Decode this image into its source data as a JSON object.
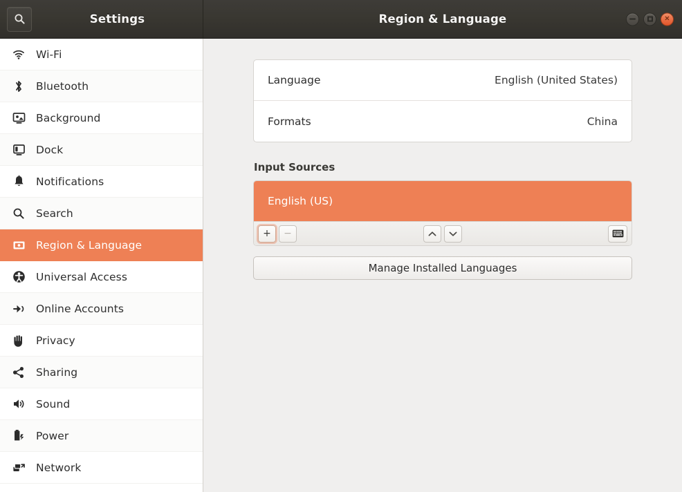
{
  "titlebar": {
    "sidebar_title": "Settings",
    "main_title": "Region & Language",
    "search_icon": "search-icon",
    "window_buttons": {
      "minimize": "minimize-icon",
      "maximize": "maximize-icon",
      "close": "close-icon",
      "close_glyph": "×"
    }
  },
  "sidebar": {
    "items": [
      {
        "label": "Wi-Fi",
        "icon": "wifi-icon",
        "selected": false
      },
      {
        "label": "Bluetooth",
        "icon": "bluetooth-icon",
        "selected": false
      },
      {
        "label": "Background",
        "icon": "background-icon",
        "selected": false
      },
      {
        "label": "Dock",
        "icon": "dock-icon",
        "selected": false
      },
      {
        "label": "Notifications",
        "icon": "bell-icon",
        "selected": false
      },
      {
        "label": "Search",
        "icon": "search-icon",
        "selected": false
      },
      {
        "label": "Region & Language",
        "icon": "region-language-icon",
        "selected": true
      },
      {
        "label": "Universal Access",
        "icon": "accessibility-icon",
        "selected": false
      },
      {
        "label": "Online Accounts",
        "icon": "online-accounts-icon",
        "selected": false
      },
      {
        "label": "Privacy",
        "icon": "privacy-hand-icon",
        "selected": false
      },
      {
        "label": "Sharing",
        "icon": "share-icon",
        "selected": false
      },
      {
        "label": "Sound",
        "icon": "speaker-icon",
        "selected": false
      },
      {
        "label": "Power",
        "icon": "power-battery-icon",
        "selected": false
      },
      {
        "label": "Network",
        "icon": "network-icon",
        "selected": false
      }
    ]
  },
  "main": {
    "settings_rows": [
      {
        "key": "Language",
        "value": "English (United States)"
      },
      {
        "key": "Formats",
        "value": "China"
      }
    ],
    "input_sources": {
      "section_title": "Input Sources",
      "items": [
        {
          "label": "English (US)",
          "selected": true
        }
      ],
      "toolbar": {
        "add_label": "+",
        "remove_label": "−",
        "move_up_icon": "chevron-up-icon",
        "move_down_icon": "chevron-down-icon",
        "keyboard_icon": "keyboard-icon"
      }
    },
    "manage_button_label": "Manage Installed Languages"
  },
  "colors": {
    "accent_orange": "#ee8055",
    "titlebar_dark": "#393731",
    "content_bg": "#f0efee",
    "sidebar_bg": "#ffffff",
    "close_button": "#e2552a"
  }
}
